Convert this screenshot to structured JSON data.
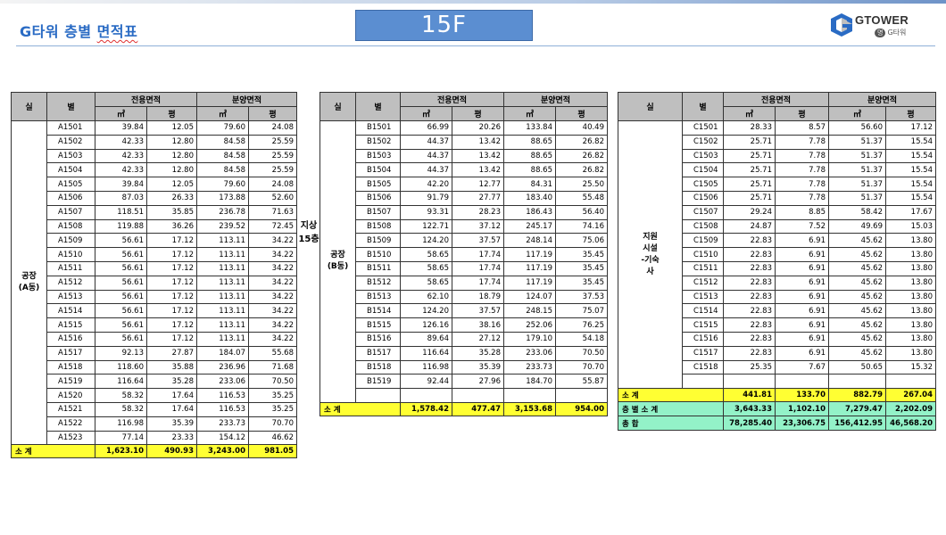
{
  "page": {
    "title_prefix": "G타워 층별 ",
    "title_squiggle": "면적표",
    "floor": "15F",
    "floor_label": "지상\n15층"
  },
  "logo": {
    "wordmark": "GTOWER",
    "pill": "명",
    "sub": "G타워",
    "colors": {
      "blue": "#2a6bc4",
      "gray": "#8a8a8a"
    }
  },
  "headers": {
    "sil": "실",
    "byeol": "별",
    "exclusive": "전용면적",
    "sale": "분양면적",
    "m2": "㎡",
    "pyeong": "평"
  },
  "tables": [
    {
      "zone": "공장\n(A동)",
      "rows": [
        [
          "A1501",
          "39.84",
          "12.05",
          "79.60",
          "24.08"
        ],
        [
          "A1502",
          "42.33",
          "12.80",
          "84.58",
          "25.59"
        ],
        [
          "A1503",
          "42.33",
          "12.80",
          "84.58",
          "25.59"
        ],
        [
          "A1504",
          "42.33",
          "12.80",
          "84.58",
          "25.59"
        ],
        [
          "A1505",
          "39.84",
          "12.05",
          "79.60",
          "24.08"
        ],
        [
          "A1506",
          "87.03",
          "26.33",
          "173.88",
          "52.60"
        ],
        [
          "A1507",
          "118.51",
          "35.85",
          "236.78",
          "71.63"
        ],
        [
          "A1508",
          "119.88",
          "36.26",
          "239.52",
          "72.45"
        ],
        [
          "A1509",
          "56.61",
          "17.12",
          "113.11",
          "34.22"
        ],
        [
          "A1510",
          "56.61",
          "17.12",
          "113.11",
          "34.22"
        ],
        [
          "A1511",
          "56.61",
          "17.12",
          "113.11",
          "34.22"
        ],
        [
          "A1512",
          "56.61",
          "17.12",
          "113.11",
          "34.22"
        ],
        [
          "A1513",
          "56.61",
          "17.12",
          "113.11",
          "34.22"
        ],
        [
          "A1514",
          "56.61",
          "17.12",
          "113.11",
          "34.22"
        ],
        [
          "A1515",
          "56.61",
          "17.12",
          "113.11",
          "34.22"
        ],
        [
          "A1516",
          "56.61",
          "17.12",
          "113.11",
          "34.22"
        ],
        [
          "A1517",
          "92.13",
          "27.87",
          "184.07",
          "55.68"
        ],
        [
          "A1518",
          "118.60",
          "35.88",
          "236.96",
          "71.68"
        ],
        [
          "A1519",
          "116.64",
          "35.28",
          "233.06",
          "70.50"
        ],
        [
          "A1520",
          "58.32",
          "17.64",
          "116.53",
          "35.25"
        ],
        [
          "A1521",
          "58.32",
          "17.64",
          "116.53",
          "35.25"
        ],
        [
          "A1522",
          "116.98",
          "35.39",
          "233.73",
          "70.70"
        ],
        [
          "A1523",
          "77.14",
          "23.33",
          "154.12",
          "46.62"
        ]
      ],
      "subtotal": {
        "label": "소  계",
        "values": [
          "1,623.10",
          "490.93",
          "3,243.00",
          "981.05"
        ]
      }
    },
    {
      "zone": "공장\n(B동)",
      "rows": [
        [
          "B1501",
          "66.99",
          "20.26",
          "133.84",
          "40.49"
        ],
        [
          "B1502",
          "44.37",
          "13.42",
          "88.65",
          "26.82"
        ],
        [
          "B1503",
          "44.37",
          "13.42",
          "88.65",
          "26.82"
        ],
        [
          "B1504",
          "44.37",
          "13.42",
          "88.65",
          "26.82"
        ],
        [
          "B1505",
          "42.20",
          "12.77",
          "84.31",
          "25.50"
        ],
        [
          "B1506",
          "91.79",
          "27.77",
          "183.40",
          "55.48"
        ],
        [
          "B1507",
          "93.31",
          "28.23",
          "186.43",
          "56.40"
        ],
        [
          "B1508",
          "122.71",
          "37.12",
          "245.17",
          "74.16"
        ],
        [
          "B1509",
          "124.20",
          "37.57",
          "248.14",
          "75.06"
        ],
        [
          "B1510",
          "58.65",
          "17.74",
          "117.19",
          "35.45"
        ],
        [
          "B1511",
          "58.65",
          "17.74",
          "117.19",
          "35.45"
        ],
        [
          "B1512",
          "58.65",
          "17.74",
          "117.19",
          "35.45"
        ],
        [
          "B1513",
          "62.10",
          "18.79",
          "124.07",
          "37.53"
        ],
        [
          "B1514",
          "124.20",
          "37.57",
          "248.15",
          "75.07"
        ],
        [
          "B1515",
          "126.16",
          "38.16",
          "252.06",
          "76.25"
        ],
        [
          "B1516",
          "89.64",
          "27.12",
          "179.10",
          "54.18"
        ],
        [
          "B1517",
          "116.64",
          "35.28",
          "233.06",
          "70.50"
        ],
        [
          "B1518",
          "116.98",
          "35.39",
          "233.73",
          "70.70"
        ],
        [
          "B1519",
          "92.44",
          "27.96",
          "184.70",
          "55.87"
        ]
      ],
      "subtotal": {
        "label": "소  계",
        "values": [
          "1,578.42",
          "477.47",
          "3,153.68",
          "954.00"
        ]
      }
    },
    {
      "zone": "지원\n시설\n-기숙\n사",
      "rows": [
        [
          "C1501",
          "28.33",
          "8.57",
          "56.60",
          "17.12"
        ],
        [
          "C1502",
          "25.71",
          "7.78",
          "51.37",
          "15.54"
        ],
        [
          "C1503",
          "25.71",
          "7.78",
          "51.37",
          "15.54"
        ],
        [
          "C1504",
          "25.71",
          "7.78",
          "51.37",
          "15.54"
        ],
        [
          "C1505",
          "25.71",
          "7.78",
          "51.37",
          "15.54"
        ],
        [
          "C1506",
          "25.71",
          "7.78",
          "51.37",
          "15.54"
        ],
        [
          "C1507",
          "29.24",
          "8.85",
          "58.42",
          "17.67"
        ],
        [
          "C1508",
          "24.87",
          "7.52",
          "49.69",
          "15.03"
        ],
        [
          "C1509",
          "22.83",
          "6.91",
          "45.62",
          "13.80"
        ],
        [
          "C1510",
          "22.83",
          "6.91",
          "45.62",
          "13.80"
        ],
        [
          "C1511",
          "22.83",
          "6.91",
          "45.62",
          "13.80"
        ],
        [
          "C1512",
          "22.83",
          "6.91",
          "45.62",
          "13.80"
        ],
        [
          "C1513",
          "22.83",
          "6.91",
          "45.62",
          "13.80"
        ],
        [
          "C1514",
          "22.83",
          "6.91",
          "45.62",
          "13.80"
        ],
        [
          "C1515",
          "22.83",
          "6.91",
          "45.62",
          "13.80"
        ],
        [
          "C1516",
          "22.83",
          "6.91",
          "45.62",
          "13.80"
        ],
        [
          "C1517",
          "22.83",
          "6.91",
          "45.62",
          "13.80"
        ],
        [
          "C1518",
          "25.35",
          "7.67",
          "50.65",
          "15.32"
        ]
      ],
      "subtotal": {
        "label": "소  계",
        "values": [
          "441.81",
          "133.70",
          "882.79",
          "267.04"
        ]
      },
      "floor_subtotal": {
        "label": "층 별 소 계",
        "values": [
          "3,643.33",
          "1,102.10",
          "7,279.47",
          "2,202.09"
        ]
      },
      "grand_total": {
        "label": "총     합",
        "values": [
          "78,285.40",
          "23,306.75",
          "156,412.95",
          "46,568.20"
        ]
      }
    }
  ]
}
